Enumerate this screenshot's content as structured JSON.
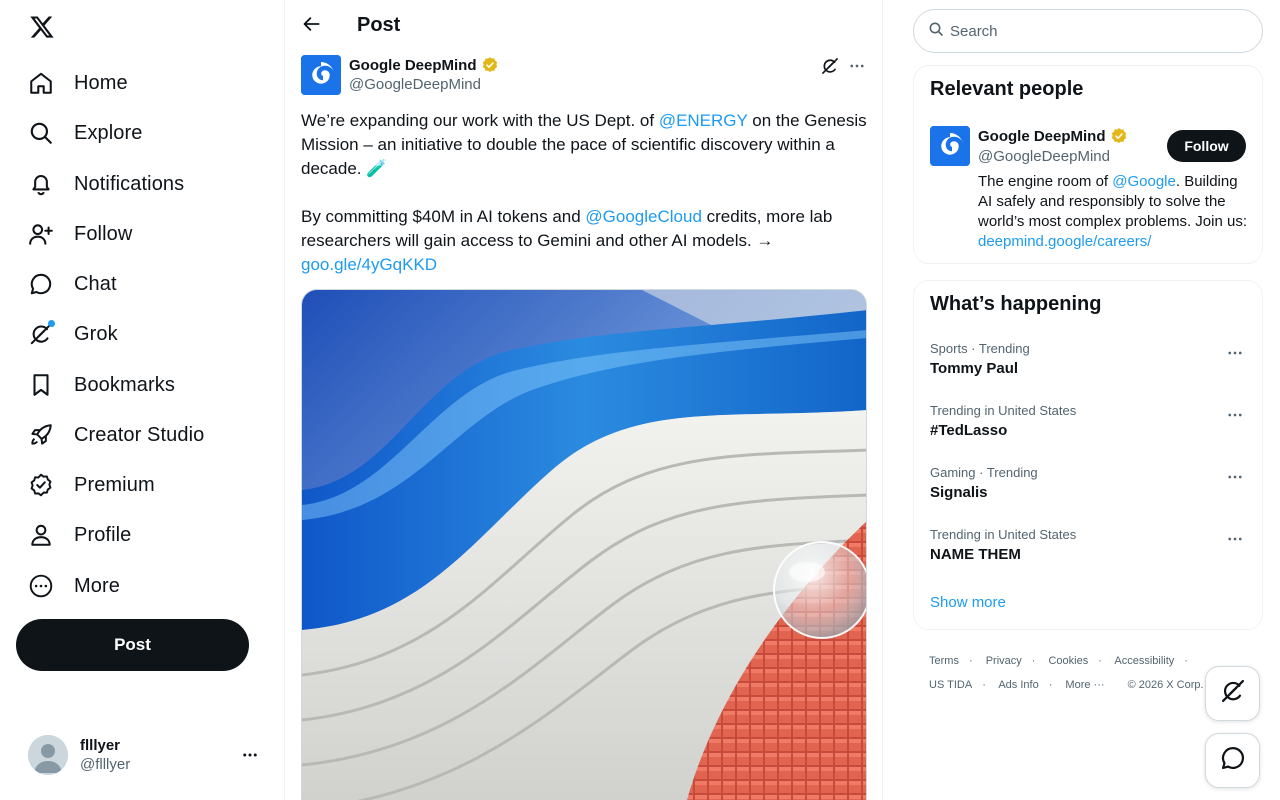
{
  "nav": {
    "items": [
      {
        "label": "Home",
        "icon": "home-icon"
      },
      {
        "label": "Explore",
        "icon": "search-icon"
      },
      {
        "label": "Notifications",
        "icon": "bell-icon"
      },
      {
        "label": "Follow",
        "icon": "add-person-icon"
      },
      {
        "label": "Chat",
        "icon": "chat-bubble-icon"
      },
      {
        "label": "Grok",
        "icon": "grok-icon"
      },
      {
        "label": "Bookmarks",
        "icon": "bookmark-icon"
      },
      {
        "label": "Creator Studio",
        "icon": "rocket-icon"
      },
      {
        "label": "Premium",
        "icon": "verified-badge-icon"
      },
      {
        "label": "Profile",
        "icon": "person-icon"
      },
      {
        "label": "More",
        "icon": "more-circle-icon"
      }
    ],
    "post_label": "Post",
    "account": {
      "name": "flllyer",
      "handle": "@flllyer"
    }
  },
  "header": {
    "title": "Post"
  },
  "post": {
    "author_name": "Google DeepMind",
    "author_handle": "@GoogleDeepMind",
    "p1_before": "We’re expanding our work with the US Dept. of ",
    "p1_mention": "@ENERGY",
    "p1_after": " on the Genesis Mission – an initiative to double the pace of scientific discovery within a decade. 🧪",
    "p2_before": "By committing $40M in AI tokens and ",
    "p2_mention": "@GoogleCloud",
    "p2_after": " credits, more lab researchers will gain access to Gemini and other AI models. → ",
    "link": "goo.gle/4yGqKKD"
  },
  "search": {
    "placeholder": "Search"
  },
  "relevant": {
    "title": "Relevant people",
    "name": "Google DeepMind",
    "handle": "@GoogleDeepMind",
    "follow_label": "Follow",
    "bio_before": "The engine room of ",
    "bio_mention": "@Google",
    "bio_middle": ". Building AI safely and responsibly to solve the world’s most complex problems. Join us: ",
    "bio_link": "deepmind.google/careers/"
  },
  "happening": {
    "title": "What’s happening",
    "trends": [
      {
        "meta": "Sports · Trending",
        "title": "Tommy Paul"
      },
      {
        "meta": "Trending in United States",
        "title": "#TedLasso"
      },
      {
        "meta": "Gaming · Trending",
        "title": "Signalis"
      },
      {
        "meta": "Trending in United States",
        "title": "NAME THEM"
      }
    ],
    "show_more": "Show more"
  },
  "footer": {
    "terms": "Terms",
    "privacy": "Privacy",
    "cookies": "Cookies",
    "accessibility": "Accessibility",
    "ustida": "US TIDA",
    "ads_info": "Ads Info",
    "more": "More ···",
    "copyright": "© 2026 X Corp."
  },
  "colors": {
    "accent": "#1d9bf0",
    "text": "#0f1419",
    "muted": "#536471",
    "verified_gold": "#e2b719"
  }
}
